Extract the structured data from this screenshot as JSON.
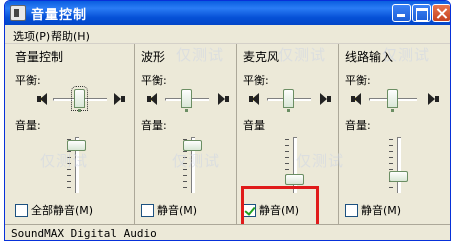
{
  "window": {
    "title": "音量控制"
  },
  "menu": [
    {
      "label": "选项(P)"
    },
    {
      "label": "帮助(H)"
    }
  ],
  "panels": [
    {
      "title": "音量控制",
      "balance_label": "平衡:",
      "volume_label": "音量:",
      "mute_label": "全部静音(M)",
      "mute_checked": false,
      "balance": 0.5,
      "volume": 0.85
    },
    {
      "title": "波形",
      "balance_label": "平衡:",
      "volume_label": "音量:",
      "mute_label": "静音(M)",
      "mute_checked": false,
      "balance": 0.5,
      "volume": 0.85
    },
    {
      "title": "麦克风",
      "balance_label": "平衡:",
      "volume_label": "音量",
      "mute_label": "静音(M)",
      "mute_checked": true,
      "balance": 0.5,
      "volume": 0.25
    },
    {
      "title": "线路输入",
      "balance_label": "平衡:",
      "volume_label": "音量:",
      "mute_label": "静音(M)",
      "mute_checked": false,
      "balance": 0.5,
      "volume": 0.3
    }
  ],
  "status": {
    "text": "SoundMAX Digital Audio"
  },
  "watermark": {
    "text": "仅测试"
  },
  "colors": {
    "title_bar": "#0a5ee0",
    "highlight": "#e01b1b",
    "window_bg": "#ece9d8"
  }
}
